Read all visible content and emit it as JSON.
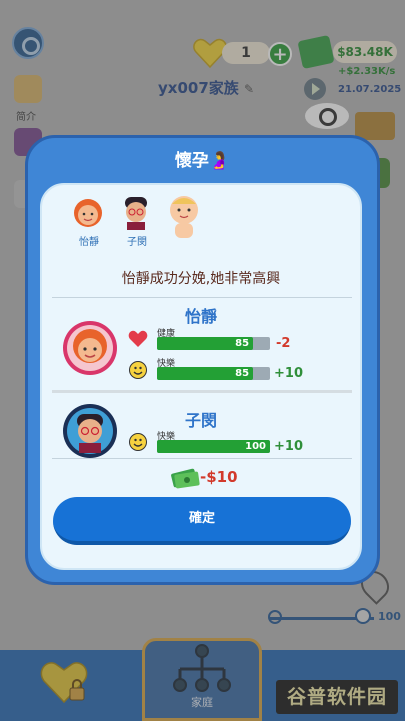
{
  "hud": {
    "hearts_count": "1",
    "plus_label": "+",
    "money": "$83.48K",
    "money_rate": "+$2.33K/s",
    "family_name": "yx007家族",
    "date": "21.07.2025",
    "zoom_value": "100",
    "home_tab_label": "家庭"
  },
  "side_menu": {
    "item1_label": "简介"
  },
  "modal": {
    "title": "懷孕🤰",
    "family_members": [
      {
        "name": "怡靜",
        "skin": "#f4b98f",
        "hair": "#e8632b"
      },
      {
        "name": "子閔",
        "skin": "#e8b18a",
        "hair": "#2a1f2b"
      },
      {
        "name": "",
        "skin": "#f7c9a3",
        "hair": "#f0c45b"
      }
    ],
    "story": "怡靜成功分娩,她非常高興",
    "person1": {
      "name": "怡靜",
      "stats": [
        {
          "label": "健康",
          "value": 85,
          "display": "85",
          "delta": "-2",
          "icon": "heart-icon"
        },
        {
          "label": "快樂",
          "value": 85,
          "display": "85",
          "delta": "+10",
          "icon": "smile-icon"
        }
      ]
    },
    "person2": {
      "name": "子閔",
      "stats": [
        {
          "label": "快樂",
          "value": 100,
          "display": "100",
          "delta": "+10",
          "icon": "smile-icon"
        }
      ]
    },
    "cost": "-$10",
    "confirm_label": "確定"
  },
  "watermark": "谷普软件园",
  "colors": {
    "modal_blue": "#3f86d6",
    "bar_green": "#23a035",
    "negative_red": "#d23a2c",
    "positive_green": "#2f8f3a"
  }
}
